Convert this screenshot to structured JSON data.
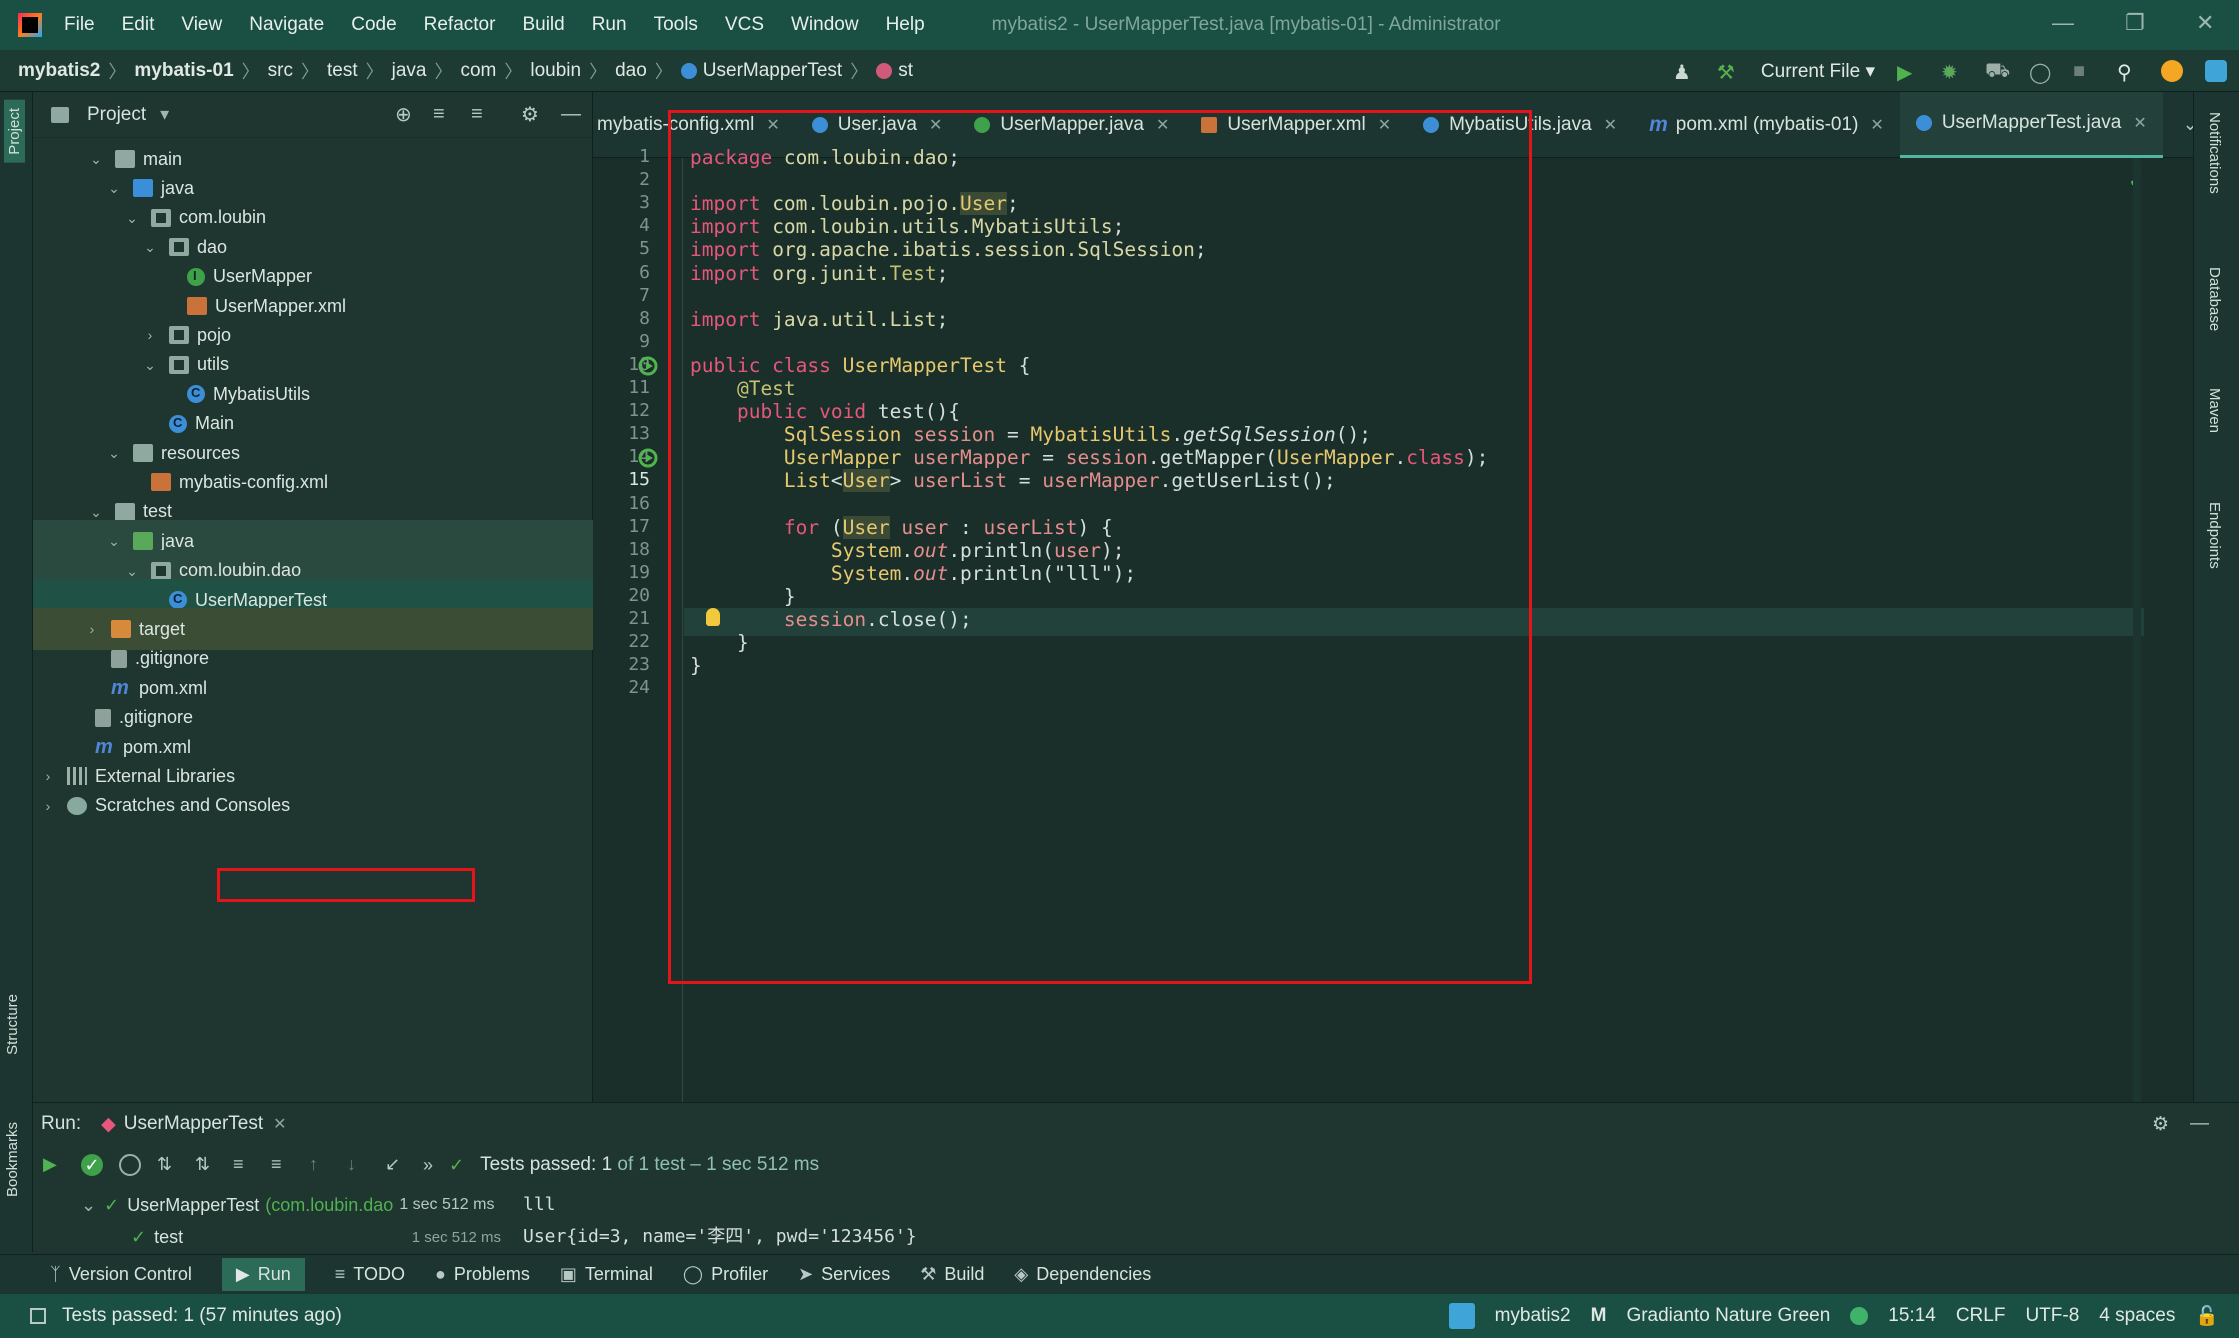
{
  "menubar": {
    "items": [
      "File",
      "Edit",
      "View",
      "Navigate",
      "Code",
      "Refactor",
      "Build",
      "Run",
      "Tools",
      "VCS",
      "Window",
      "Help"
    ],
    "window_title": "mybatis2 - UserMapperTest.java [mybatis-01] - Administrator"
  },
  "breadcrumb": [
    "mybatis2",
    "mybatis-01",
    "src",
    "test",
    "java",
    "com",
    "loubin",
    "dao",
    "UserMapperTest",
    "st"
  ],
  "toolbar": {
    "run_config": "Current File"
  },
  "project_panel": {
    "title": "Project",
    "tree": [
      {
        "label": "main",
        "depth": 0,
        "icon": "folder",
        "expanded": true
      },
      {
        "label": "java",
        "depth": 1,
        "icon": "folder-blue",
        "expanded": true
      },
      {
        "label": "com.loubin",
        "depth": 2,
        "icon": "package",
        "expanded": true
      },
      {
        "label": "dao",
        "depth": 3,
        "icon": "package",
        "expanded": true
      },
      {
        "label": "UserMapper",
        "depth": 4,
        "icon": "interface"
      },
      {
        "label": "UserMapper.xml",
        "depth": 4,
        "icon": "xml"
      },
      {
        "label": "pojo",
        "depth": 3,
        "icon": "package",
        "expanded": false
      },
      {
        "label": "utils",
        "depth": 3,
        "icon": "package",
        "expanded": true
      },
      {
        "label": "MybatisUtils",
        "depth": 4,
        "icon": "class"
      },
      {
        "label": "Main",
        "depth": 3,
        "icon": "class"
      },
      {
        "label": "resources",
        "depth": 1,
        "icon": "folder",
        "expanded": true
      },
      {
        "label": "mybatis-config.xml",
        "depth": 2,
        "icon": "xml"
      },
      {
        "label": "test",
        "depth": 0,
        "icon": "folder",
        "expanded": true
      },
      {
        "label": "java",
        "depth": 1,
        "icon": "folder-green",
        "expanded": true
      },
      {
        "label": "com.loubin.dao",
        "depth": 2,
        "icon": "package",
        "expanded": true
      },
      {
        "label": "UserMapperTest",
        "depth": 3,
        "icon": "class"
      },
      {
        "label": "target",
        "depth": -1,
        "icon": "folder-orange",
        "expanded": false
      },
      {
        "label": ".gitignore",
        "depth": -1,
        "icon": "git"
      },
      {
        "label": "pom.xml",
        "depth": -1,
        "icon": "maven"
      },
      {
        "label": ".gitignore",
        "depth": -2,
        "icon": "git"
      },
      {
        "label": "pom.xml",
        "depth": -2,
        "icon": "maven"
      },
      {
        "label": "External Libraries",
        "depth": -3,
        "icon": "lib",
        "expanded": false
      },
      {
        "label": "Scratches and Consoles",
        "depth": -3,
        "icon": "scratch",
        "expanded": false
      }
    ]
  },
  "editor_tabs": [
    {
      "label": "mybatis-config.xml",
      "icon": "xml"
    },
    {
      "label": "User.java",
      "icon": "class"
    },
    {
      "label": "UserMapper.java",
      "icon": "interface"
    },
    {
      "label": "UserMapper.xml",
      "icon": "xml"
    },
    {
      "label": "MybatisUtils.java",
      "icon": "class"
    },
    {
      "label": "pom.xml (mybatis-01)",
      "icon": "maven"
    },
    {
      "label": "UserMapperTest.java",
      "icon": "class",
      "active": true
    }
  ],
  "code": {
    "lines": [
      [
        {
          "c": "k",
          "t": "package "
        },
        {
          "c": "pk",
          "t": "com.loubin.dao"
        },
        {
          "c": "m",
          "t": ";"
        }
      ],
      [],
      [
        {
          "c": "k",
          "t": "import "
        },
        {
          "c": "pk",
          "t": "com.loubin.pojo."
        },
        {
          "c": "t hl",
          "t": "User"
        },
        {
          "c": "m",
          "t": ";"
        }
      ],
      [
        {
          "c": "k",
          "t": "import "
        },
        {
          "c": "pk",
          "t": "com.loubin.utils.MybatisUtils"
        },
        {
          "c": "m",
          "t": ";"
        }
      ],
      [
        {
          "c": "k",
          "t": "import "
        },
        {
          "c": "pk",
          "t": "org.apache.ibatis.session.SqlSession"
        },
        {
          "c": "m",
          "t": ";"
        }
      ],
      [
        {
          "c": "k",
          "t": "import "
        },
        {
          "c": "pk",
          "t": "org.junit."
        },
        {
          "c": "an",
          "t": "Test"
        },
        {
          "c": "m",
          "t": ";"
        }
      ],
      [],
      [
        {
          "c": "k",
          "t": "import "
        },
        {
          "c": "pk",
          "t": "java.util.List"
        },
        {
          "c": "m",
          "t": ";"
        }
      ],
      [],
      [
        {
          "c": "k",
          "t": "public class "
        },
        {
          "c": "t",
          "t": "UserMapperTest"
        },
        {
          "c": "m",
          "t": " {"
        }
      ],
      [
        {
          "c": "an",
          "t": "    @Test"
        }
      ],
      [
        {
          "c": "k",
          "t": "    public void "
        },
        {
          "c": "m",
          "t": "test(){"
        }
      ],
      [
        {
          "c": "t",
          "t": "        SqlSession "
        },
        {
          "c": "v",
          "t": "session"
        },
        {
          "c": "m",
          "t": " = "
        },
        {
          "c": "t",
          "t": "MybatisUtils"
        },
        {
          "c": "m",
          "t": "."
        },
        {
          "c": "m it",
          "t": "getSqlSession"
        },
        {
          "c": "m",
          "t": "();"
        }
      ],
      [
        {
          "c": "t",
          "t": "        UserMapper "
        },
        {
          "c": "v",
          "t": "userMapper"
        },
        {
          "c": "m",
          "t": " = "
        },
        {
          "c": "v",
          "t": "session"
        },
        {
          "c": "m",
          "t": ".getMapper("
        },
        {
          "c": "t",
          "t": "UserMapper"
        },
        {
          "c": "m",
          "t": "."
        },
        {
          "c": "k",
          "t": "class"
        },
        {
          "c": "m",
          "t": ");"
        }
      ],
      [
        {
          "c": "t",
          "t": "        List"
        },
        {
          "c": "m",
          "t": "<"
        },
        {
          "c": "t hl",
          "t": "User"
        },
        {
          "c": "m",
          "t": "> "
        },
        {
          "c": "v",
          "t": "userList"
        },
        {
          "c": "m",
          "t": " = "
        },
        {
          "c": "v",
          "t": "userMapper"
        },
        {
          "c": "m",
          "t": ".getUserList();"
        }
      ],
      [],
      [
        {
          "c": "k",
          "t": "        for "
        },
        {
          "c": "m",
          "t": "("
        },
        {
          "c": "t hl",
          "t": "User"
        },
        {
          "c": "v",
          "t": " user"
        },
        {
          "c": "m",
          "t": " : "
        },
        {
          "c": "v",
          "t": "userList"
        },
        {
          "c": "m",
          "t": ") {"
        }
      ],
      [
        {
          "c": "t",
          "t": "            System"
        },
        {
          "c": "m",
          "t": "."
        },
        {
          "c": "v it",
          "t": "out"
        },
        {
          "c": "m",
          "t": ".println("
        },
        {
          "c": "v",
          "t": "user"
        },
        {
          "c": "m",
          "t": ");"
        }
      ],
      [
        {
          "c": "t",
          "t": "            System"
        },
        {
          "c": "m",
          "t": "."
        },
        {
          "c": "v it",
          "t": "out"
        },
        {
          "c": "m",
          "t": ".println("
        },
        {
          "c": "s",
          "t": "\"lll\""
        },
        {
          "c": "m",
          "t": ");"
        }
      ],
      [
        {
          "c": "m",
          "t": "        }"
        }
      ],
      [
        {
          "c": "v",
          "t": "        session"
        },
        {
          "c": "m",
          "t": ".close();"
        }
      ],
      [
        {
          "c": "m",
          "t": "    }"
        }
      ],
      [
        {
          "c": "m",
          "t": "}"
        }
      ],
      []
    ],
    "current_line": 15
  },
  "right_stripe": [
    "Notifications",
    "Database",
    "Maven",
    "Endpoints"
  ],
  "left_stripe": [
    "Project",
    "Structure",
    "Bookmarks"
  ],
  "run_panel": {
    "label": "Run:",
    "tab": "UserMapperTest",
    "status": "Tests passed:",
    "passed_count": "1",
    "summary": "of 1 test – 1 sec 512 ms",
    "tree_root": "UserMapperTest",
    "tree_root_pkg": "(com.loubin.dao",
    "tree_root_time": "1 sec 512 ms",
    "tree_child": "test",
    "tree_child_time": "1 sec 512 ms",
    "console_lines": [
      "lll",
      "User{id=3, name='李四', pwd='123456'}"
    ]
  },
  "bottom_tabs": [
    "Version Control",
    "Run",
    "TODO",
    "Problems",
    "Terminal",
    "Profiler",
    "Services",
    "Build",
    "Dependencies"
  ],
  "status": {
    "message": "Tests passed: 1 (57 minutes ago)",
    "project": "mybatis2",
    "theme": "Gradianto Nature Green",
    "position": "15:14",
    "line_sep": "CRLF",
    "encoding": "UTF-8",
    "indent": "4 spaces"
  },
  "colors": {
    "accent": "#4fb6a1",
    "highlight_border": "#e4141a",
    "status_bar": "#1a4f44"
  }
}
